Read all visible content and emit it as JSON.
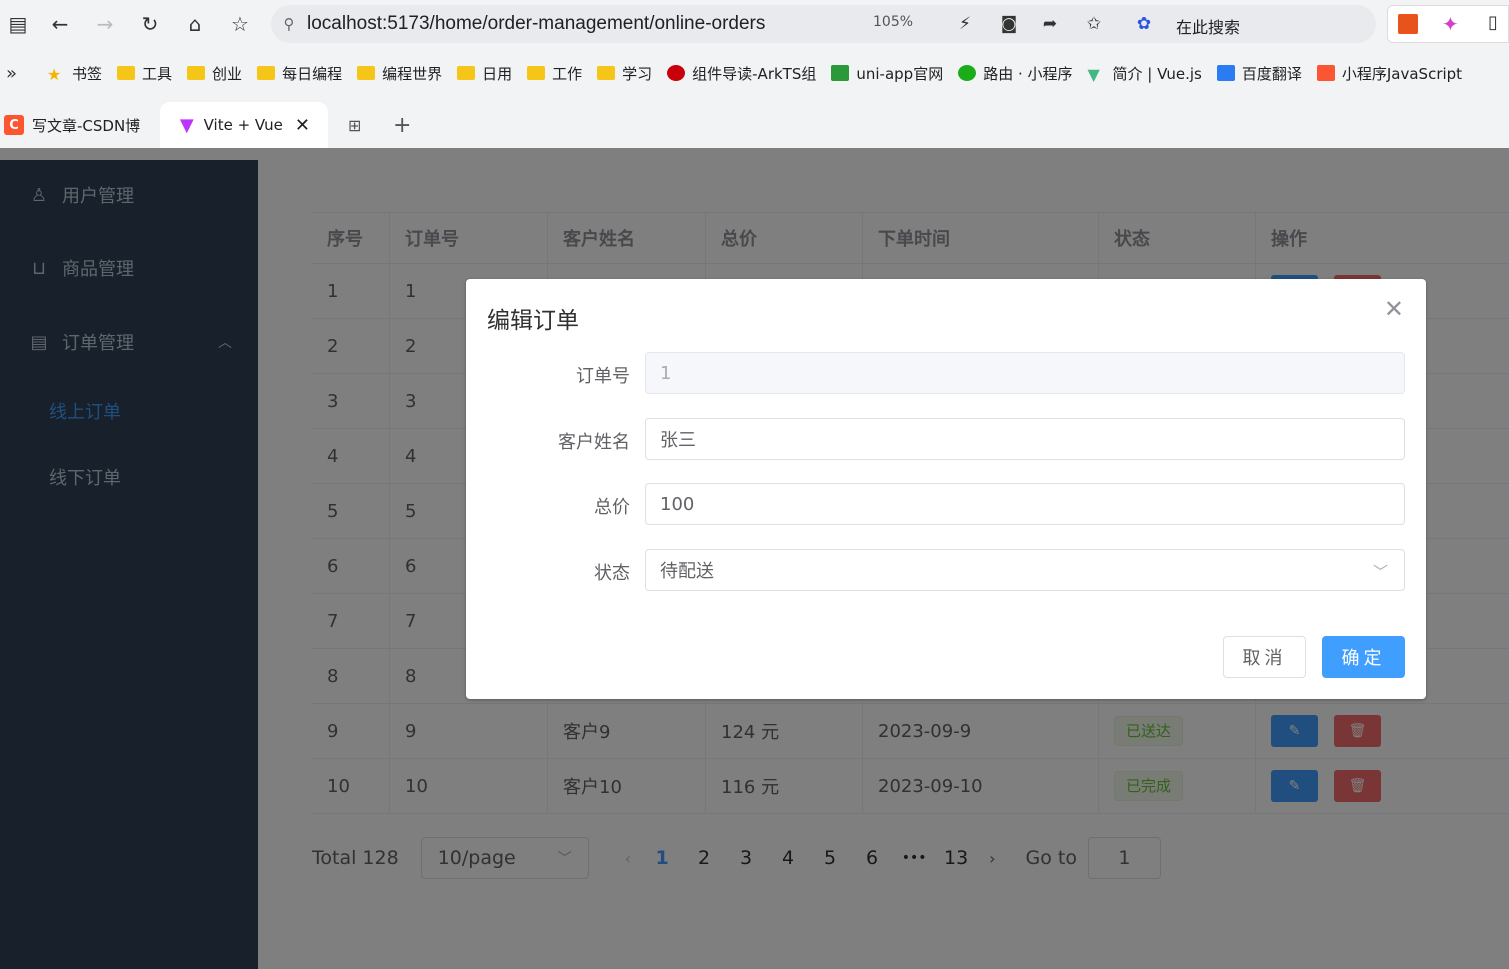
{
  "browser": {
    "url": "localhost:5173/home/order-management/online-orders",
    "zoom": "105%",
    "search_label": "在此搜索",
    "bookmarks": [
      "书签",
      "工具",
      "创业",
      "每日编程",
      "编程世界",
      "日用",
      "工作",
      "学习",
      "组件导读-ArkTS组",
      "uni-app官网",
      "路由 · 小程序",
      "简介 | Vue.js",
      "百度翻译",
      "小程序JavaScript"
    ],
    "tabs": [
      {
        "label": "写文章-CSDN博"
      },
      {
        "label": "Vite + Vue"
      }
    ]
  },
  "sidebar": {
    "items": [
      {
        "label": "用户管理"
      },
      {
        "label": "商品管理"
      },
      {
        "label": "订单管理"
      }
    ],
    "sub_items": [
      {
        "label": "线上订单",
        "active": true
      },
      {
        "label": "线下订单",
        "active": false
      }
    ]
  },
  "table": {
    "headers": [
      "序号",
      "订单号",
      "客户姓名",
      "总价",
      "下单时间",
      "状态",
      "操作"
    ],
    "rows": [
      {
        "idx": "1",
        "order": "1",
        "customer": "",
        "total": "",
        "time": "",
        "status": ""
      },
      {
        "idx": "2",
        "order": "2",
        "customer": "",
        "total": "",
        "time": "",
        "status": ""
      },
      {
        "idx": "3",
        "order": "3",
        "customer": "",
        "total": "",
        "time": "",
        "status": ""
      },
      {
        "idx": "4",
        "order": "4",
        "customer": "",
        "total": "",
        "time": "",
        "status": ""
      },
      {
        "idx": "5",
        "order": "5",
        "customer": "",
        "total": "",
        "time": "",
        "status": ""
      },
      {
        "idx": "6",
        "order": "6",
        "customer": "",
        "total": "",
        "time": "",
        "status": ""
      },
      {
        "idx": "7",
        "order": "7",
        "customer": "",
        "total": "",
        "time": "",
        "status": ""
      },
      {
        "idx": "8",
        "order": "8",
        "customer": "",
        "total": "",
        "time": "",
        "status": ""
      },
      {
        "idx": "9",
        "order": "9",
        "customer": "客户9",
        "total": "124 元",
        "time": "2023-09-9",
        "status": "已送达"
      },
      {
        "idx": "10",
        "order": "10",
        "customer": "客户10",
        "total": "116 元",
        "time": "2023-09-10",
        "status": "已完成"
      }
    ]
  },
  "pagination": {
    "total": "Total 128",
    "page_size": "10/page",
    "pages": [
      "1",
      "2",
      "3",
      "4",
      "5",
      "6",
      "•••",
      "13"
    ],
    "current": "1",
    "goto_label": "Go to",
    "goto_value": "1"
  },
  "dialog": {
    "title": "编辑订单",
    "fields": {
      "order_no": {
        "label": "订单号",
        "value": "1"
      },
      "customer": {
        "label": "客户姓名",
        "value": "张三"
      },
      "total": {
        "label": "总价",
        "value": "100"
      },
      "status": {
        "label": "状态",
        "value": "待配送"
      }
    },
    "cancel": "取消",
    "confirm": "确定"
  }
}
